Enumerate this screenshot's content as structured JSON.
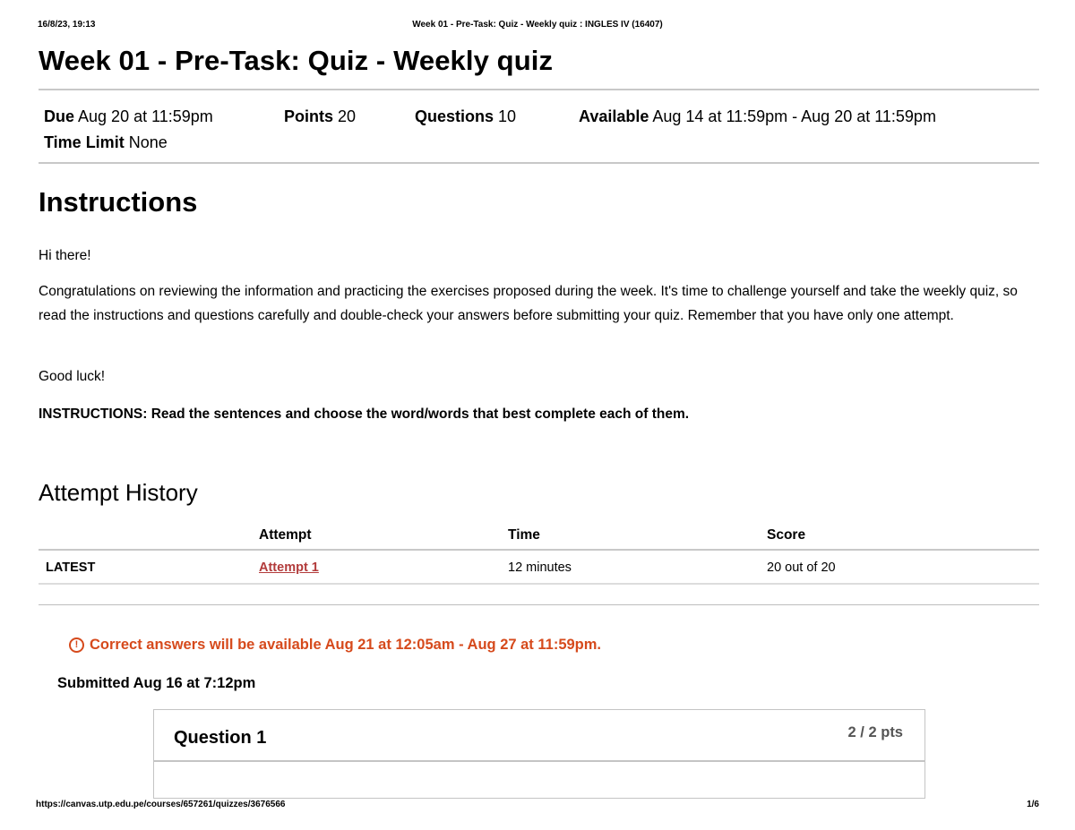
{
  "print_header": {
    "date": "16/8/23, 19:13",
    "title": "Week 01 - Pre-Task: Quiz - Weekly quiz : INGLES IV (16407)"
  },
  "page_title": "Week 01 - Pre-Task: Quiz - Weekly quiz",
  "meta": {
    "due_label": "Due",
    "due_value": " Aug 20 at 11:59pm",
    "points_label": "Points",
    "points_value": " 20",
    "questions_label": "Questions",
    "questions_value": " 10",
    "available_label": "Available",
    "available_value": " Aug 14 at 11:59pm - Aug 20 at 11:59pm",
    "time_limit_label": "Time Limit",
    "time_limit_value": " None"
  },
  "instructions": {
    "heading": "Instructions",
    "greeting": "Hi there!",
    "body": "Congratulations on reviewing the information and practicing the exercises proposed during the week. It's time to challenge yourself and take the weekly quiz, so read the instructions and questions carefully and double-check your answers before submitting your quiz. Remember that you have only one attempt.",
    "good_luck": "Good luck!",
    "directive": "INSTRUCTIONS: Read the sentences and choose the word/words that best complete each of them."
  },
  "attempt_history": {
    "heading": "Attempt History",
    "columns": [
      "",
      "Attempt",
      "Time",
      "Score"
    ],
    "rows": [
      {
        "status": "LATEST",
        "attempt": "Attempt 1",
        "time": "12 minutes",
        "score": "20 out of 20"
      }
    ]
  },
  "warning": {
    "icon": "alert-circle-icon",
    "text": "Correct answers will be available Aug 21 at 12:05am - Aug 27 at 11:59pm.",
    "color": "#d64a1c"
  },
  "submitted": "Submitted Aug 16 at 7:12pm",
  "question": {
    "title": "Question 1",
    "points": "2 / 2 pts"
  },
  "print_footer": {
    "url": "https://canvas.utp.edu.pe/courses/657261/quizzes/3676566",
    "page": "1/6"
  },
  "colors": {
    "link": "#b23b3b",
    "divider": "#c8c8c8"
  }
}
